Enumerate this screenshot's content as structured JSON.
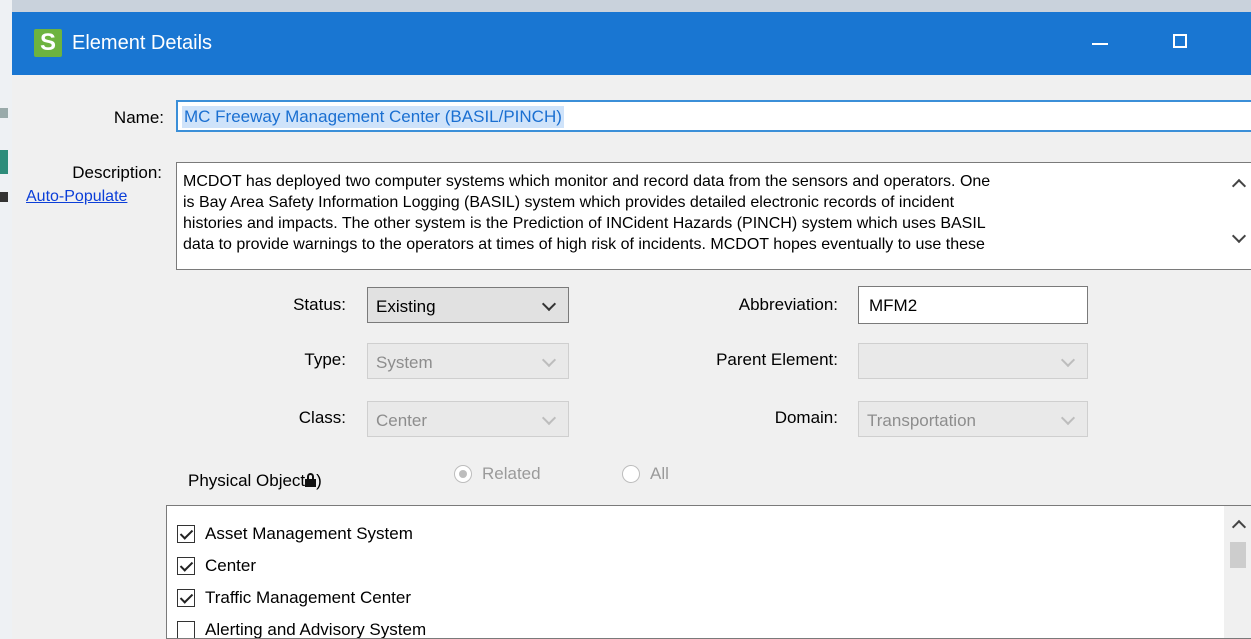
{
  "window": {
    "title": "Element Details",
    "app_icon_letter": "S",
    "accent_color": "#1976d2"
  },
  "form": {
    "name_label": "Name:",
    "name_value": "MC Freeway Management Center (BASIL/PINCH)",
    "description_label": "Description:",
    "auto_populate_link": "Auto-Populate",
    "description_lines": [
      "MCDOT has deployed two computer systems which monitor and record data from the sensors and operators. One",
      "is Bay Area Safety Information Logging (BASIL) system which provides detailed electronic records of incident",
      "histories and impacts. The other system is the Prediction of INCident Hazards (PINCH) system which uses BASIL",
      "data to provide warnings to the operators at times of high risk of incidents. MCDOT hopes eventually to use these"
    ],
    "status_label": "Status:",
    "status_value": "Existing",
    "type_label": "Type:",
    "type_value": "System",
    "class_label": "Class:",
    "class_value": "Center",
    "abbreviation_label": "Abbreviation:",
    "abbreviation_value": "MFM2",
    "parent_label": "Parent Element:",
    "parent_value": "",
    "domain_label": "Domain:",
    "domain_value": "Transportation"
  },
  "physical_objects": {
    "label": "Physical Object",
    "label_suffix": ")",
    "radio_related": "Related",
    "radio_all": "All",
    "selected_radio": "Related",
    "items": [
      {
        "label": "Asset Management System",
        "checked": true
      },
      {
        "label": "Center",
        "checked": true
      },
      {
        "label": "Traffic Management Center",
        "checked": true
      },
      {
        "label": "Alerting and Advisory System",
        "checked": false
      }
    ]
  }
}
